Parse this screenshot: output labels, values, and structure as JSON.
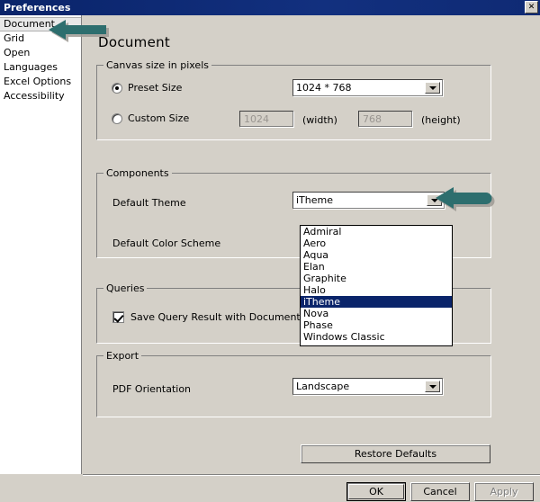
{
  "window": {
    "title": "Preferences",
    "close_label": "✕"
  },
  "sidebar": {
    "items": [
      {
        "label": "Document",
        "selected": true
      },
      {
        "label": "Grid",
        "selected": false
      },
      {
        "label": "Open",
        "selected": false
      },
      {
        "label": "Languages",
        "selected": false
      },
      {
        "label": "Excel Options",
        "selected": false
      },
      {
        "label": "Accessibility",
        "selected": false
      }
    ]
  },
  "page": {
    "title": "Document"
  },
  "canvas_group": {
    "title": "Canvas size in pixels",
    "preset_radio_label": "Preset Size",
    "preset_selected": true,
    "preset_value": "1024 * 768",
    "custom_radio_label": "Custom Size",
    "custom_selected": false,
    "width_value": "1024",
    "width_label": "(width)",
    "height_value": "768",
    "height_label": "(height)"
  },
  "components_group": {
    "title": "Components",
    "default_theme_label": "Default Theme",
    "default_theme_value": "iTheme",
    "default_color_scheme_label": "Default Color Scheme",
    "theme_options": [
      {
        "label": "Admiral",
        "selected": false
      },
      {
        "label": "Aero",
        "selected": false
      },
      {
        "label": "Aqua",
        "selected": false
      },
      {
        "label": "Elan",
        "selected": false
      },
      {
        "label": "Graphite",
        "selected": false
      },
      {
        "label": "Halo",
        "selected": false
      },
      {
        "label": "iTheme",
        "selected": true
      },
      {
        "label": "Nova",
        "selected": false
      },
      {
        "label": "Phase",
        "selected": false
      },
      {
        "label": "Windows Classic",
        "selected": false
      }
    ]
  },
  "queries_group": {
    "title": "Queries",
    "save_query_label": "Save Query Result with Document",
    "save_query_checked": true
  },
  "export_group": {
    "title": "Export",
    "pdf_orientation_label": "PDF Orientation",
    "pdf_orientation_value": "Landscape"
  },
  "buttons": {
    "restore_defaults": "Restore Defaults",
    "ok": "OK",
    "cancel": "Cancel",
    "apply": "Apply"
  },
  "annotations": {
    "arrow_color": "#2d6e6e",
    "arrow_shadow": "#9d9a94",
    "arrow_1_target": "sidebar-item-document",
    "arrow_2_target": "default-theme-combo"
  },
  "colors": {
    "titlebar": "#0a246a",
    "dialog_face": "#d4d0c8",
    "selection": "#0a246a",
    "field": "#ffffff"
  }
}
